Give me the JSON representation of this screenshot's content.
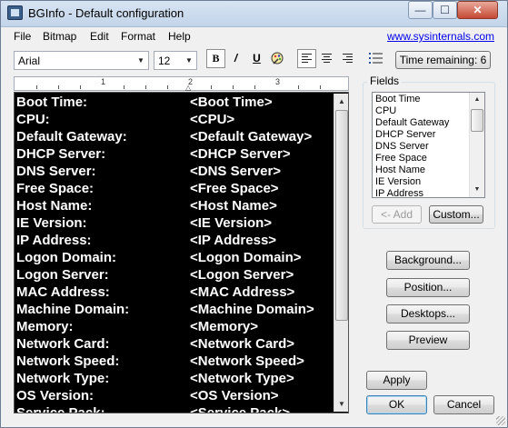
{
  "window": {
    "title": "BGInfo - Default configuration",
    "min_glyph": "—",
    "max_glyph": "☐",
    "close_glyph": "✕"
  },
  "menu": {
    "items": [
      "File",
      "Bitmap",
      "Edit",
      "Format",
      "Help"
    ],
    "site_link": "www.sysinternals.com"
  },
  "toolbar": {
    "font": "Arial",
    "size": "12",
    "bold": "B",
    "italic": "/",
    "underline": "U",
    "color_icon": "palette-icon",
    "time_remaining": "Time remaining: 6"
  },
  "ruler": {
    "numbers": [
      "1",
      "2",
      "3"
    ]
  },
  "editor": {
    "rows": [
      {
        "label": "Boot Time:",
        "value": "<Boot Time>"
      },
      {
        "label": "CPU:",
        "value": "<CPU>"
      },
      {
        "label": "Default Gateway:",
        "value": "<Default Gateway>"
      },
      {
        "label": "DHCP Server:",
        "value": "<DHCP Server>"
      },
      {
        "label": "DNS Server:",
        "value": "<DNS Server>"
      },
      {
        "label": "Free Space:",
        "value": "<Free Space>"
      },
      {
        "label": "Host Name:",
        "value": "<Host Name>"
      },
      {
        "label": "IE Version:",
        "value": "<IE Version>"
      },
      {
        "label": "IP Address:",
        "value": "<IP Address>"
      },
      {
        "label": "Logon Domain:",
        "value": "<Logon Domain>"
      },
      {
        "label": "Logon Server:",
        "value": "<Logon Server>"
      },
      {
        "label": "MAC Address:",
        "value": "<MAC Address>"
      },
      {
        "label": "Machine Domain:",
        "value": "<Machine Domain>"
      },
      {
        "label": "Memory:",
        "value": "<Memory>"
      },
      {
        "label": "Network Card:",
        "value": "<Network Card>"
      },
      {
        "label": "Network Speed:",
        "value": "<Network Speed>"
      },
      {
        "label": "Network Type:",
        "value": "<Network Type>"
      },
      {
        "label": "OS Version:",
        "value": "<OS Version>"
      },
      {
        "label": "Service Pack:",
        "value": "<Service Pack>"
      }
    ]
  },
  "fields": {
    "title": "Fields",
    "items": [
      "Boot Time",
      "CPU",
      "Default Gateway",
      "DHCP Server",
      "DNS Server",
      "Free Space",
      "Host Name",
      "IE Version",
      "IP Address"
    ],
    "add_label": "<- Add",
    "custom_label": "Custom..."
  },
  "buttons": {
    "background": "Background...",
    "position": "Position...",
    "desktops": "Desktops...",
    "preview": "Preview",
    "apply": "Apply",
    "ok": "OK",
    "cancel": "Cancel"
  }
}
